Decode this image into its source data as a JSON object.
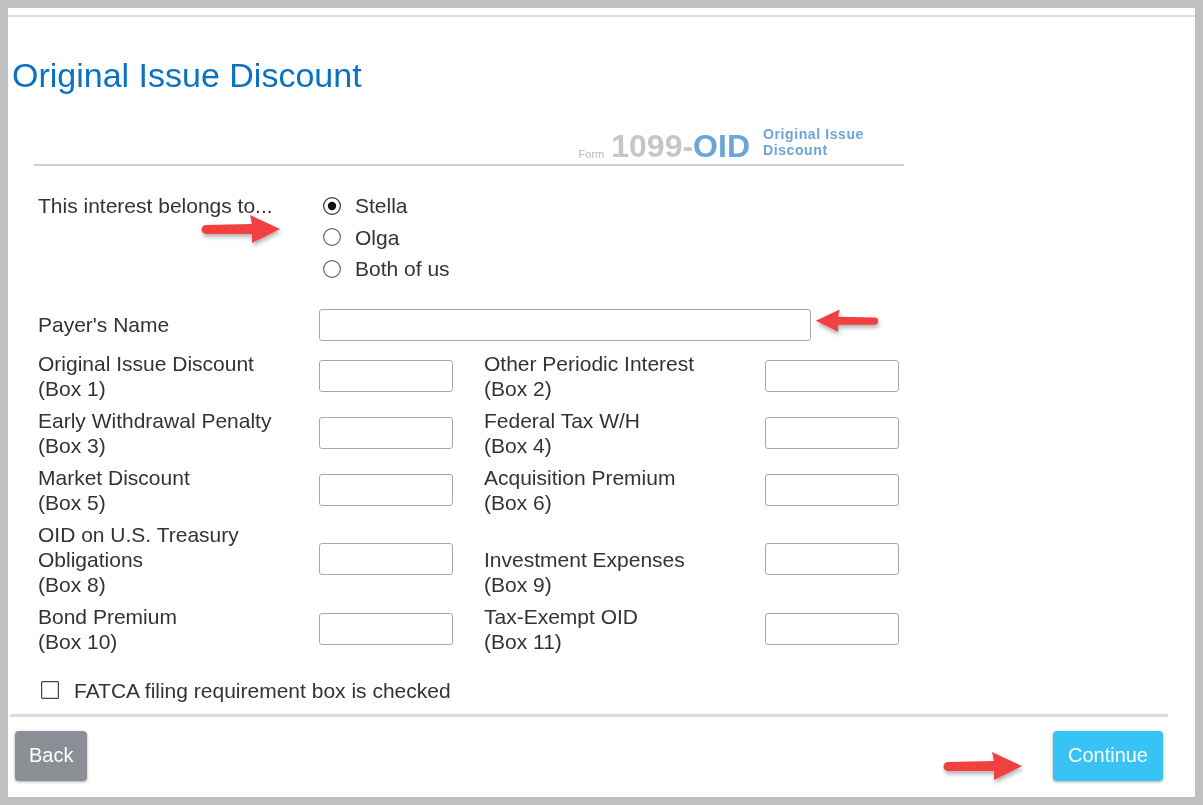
{
  "page": {
    "title": "Original Issue Discount"
  },
  "form_badge": {
    "prefix": "Form",
    "number": "1099-",
    "code": "OID",
    "caption": "Original Issue Discount"
  },
  "interest_owner": {
    "label": "This interest belongs to...",
    "arrow": {
      "kind": "right"
    },
    "options": [
      {
        "label": "Stella",
        "selected": true
      },
      {
        "label": "Olga",
        "selected": false
      },
      {
        "label": "Both of us",
        "selected": false
      }
    ]
  },
  "payer_name": {
    "label": "Payer's Name",
    "arrow": {
      "kind": "left"
    }
  },
  "amounts": [
    {
      "label": "Original Issue Discount",
      "box": "(Box 1)"
    },
    {
      "label": "Other Periodic Interest",
      "box": "(Box 2)"
    },
    {
      "label": "Early Withdrawal Penalty",
      "box": "(Box 3)"
    },
    {
      "label": "Federal Tax W/H",
      "box": "(Box 4)"
    },
    {
      "label": "Market Discount",
      "box": "(Box 5)"
    },
    {
      "label": "Acquisition Premium",
      "box": "(Box 6)"
    },
    {
      "label": "OID on U.S. Treasury Obligations",
      "box": "(Box 8)"
    },
    {
      "label": "Investment Expenses",
      "box": "(Box 9)"
    },
    {
      "label": "Bond Premium",
      "box": "(Box 10)"
    },
    {
      "label": "Tax-Exempt OID",
      "box": "(Box 11)"
    }
  ],
  "fatca": {
    "label": "FATCA filing requirement box is checked",
    "checked": false
  },
  "buttons": [
    {
      "label": "Back",
      "kind": "back"
    },
    {
      "label": "Continue",
      "kind": "continue",
      "arrow": {
        "kind": "right"
      }
    }
  ]
}
